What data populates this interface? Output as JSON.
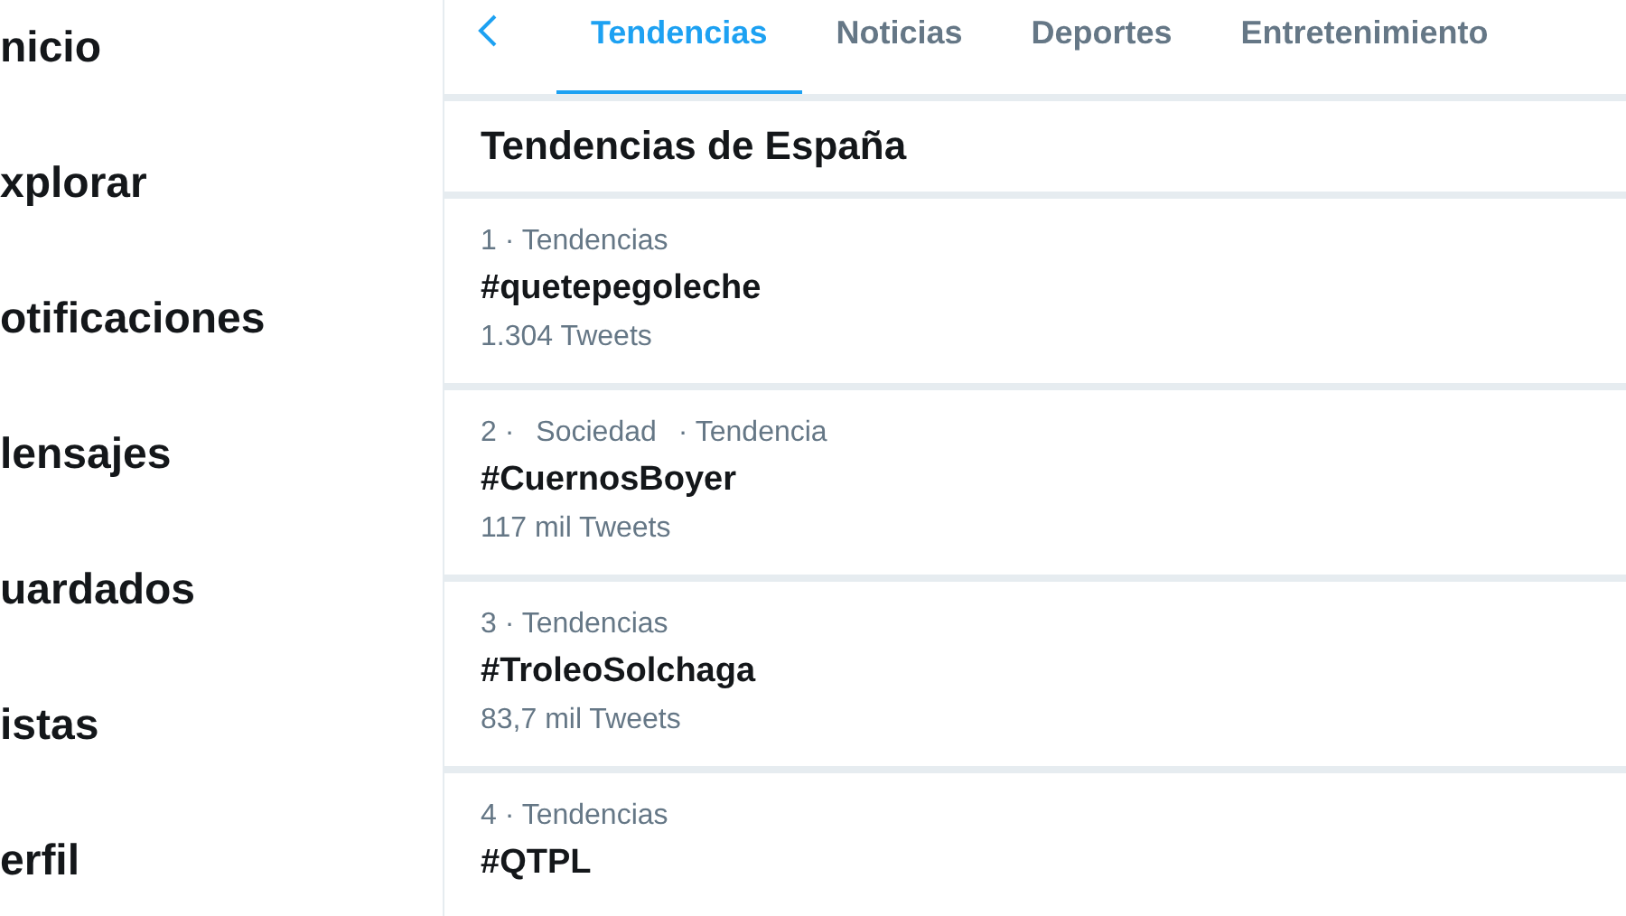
{
  "sidebar": {
    "items": [
      {
        "label": "nicio",
        "selected": false
      },
      {
        "label": "xplorar",
        "selected": false
      },
      {
        "label": "otificaciones",
        "selected": false
      },
      {
        "label": "lensajes",
        "selected": false
      },
      {
        "label": "uardados",
        "selected": false
      },
      {
        "label": "istas",
        "selected": false
      },
      {
        "label": "erfil",
        "selected": false
      }
    ]
  },
  "tabs": [
    {
      "label": "Tendencias",
      "selected": true
    },
    {
      "label": "Noticias",
      "selected": false
    },
    {
      "label": "Deportes",
      "selected": false
    },
    {
      "label": "Entretenimiento",
      "selected": false
    }
  ],
  "heading": "Tendencias de España",
  "trends": [
    {
      "meta": [
        "1 · Tendencias"
      ],
      "tag": "#quetepegoleche",
      "count": "1.304 Tweets"
    },
    {
      "meta": [
        "2 ·",
        "Sociedad",
        "· Tendencia"
      ],
      "tag": "#CuernosBoyer",
      "count": "117 mil Tweets"
    },
    {
      "meta": [
        "3 · Tendencias"
      ],
      "tag": "#TroleoSolchaga",
      "count": "83,7 mil Tweets"
    },
    {
      "meta": [
        "4 · Tendencias"
      ],
      "tag": "#QTPL"
    }
  ]
}
